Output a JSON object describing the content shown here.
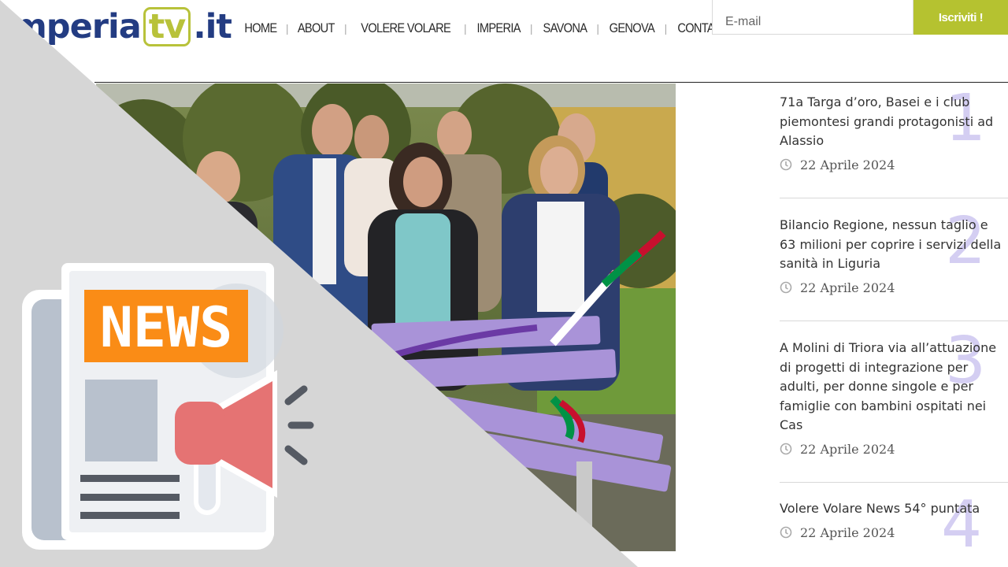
{
  "site": {
    "logo": {
      "before": "Imperia",
      "tv": "tv",
      "after": ".it"
    },
    "nav": [
      {
        "label": "HOME"
      },
      {
        "label": "ABOUT"
      },
      {
        "label": "VOLERE VOLARE"
      },
      {
        "label": "IMPERIA"
      },
      {
        "label": "SAVONA"
      },
      {
        "label": "GENOVA"
      },
      {
        "label": "CONTATTI"
      }
    ],
    "newsletter": {
      "placeholder": "E-mail",
      "button": "Iscriviti !"
    }
  },
  "overlay": {
    "badge": "NEWS"
  },
  "articles": [
    {
      "number": "1",
      "title": "71a Targa d’oro, Basei e i club piemontesi grandi protagonisti ad Alassio",
      "date": "22 Aprile 2024"
    },
    {
      "number": "2",
      "title": "Bilancio Regione, nessun taglio e 63 milioni per coprire i servizi della sanità in Liguria",
      "date": "22 Aprile 2024"
    },
    {
      "number": "3",
      "title": "A Molini di Triora via all’attuazione di progetti di integrazione per adulti, per donne singole e per famiglie con bambini ospitati nei Cas",
      "date": "22 Aprile 2024"
    },
    {
      "number": "4",
      "title": "Volere Volare News 54° puntata",
      "date": "22 Aprile 2024"
    }
  ],
  "colors": {
    "brand_blue": "#233c82",
    "brand_green": "#b5c230",
    "number_lavender": "#d4cef2",
    "news_orange": "#fa8c16"
  }
}
